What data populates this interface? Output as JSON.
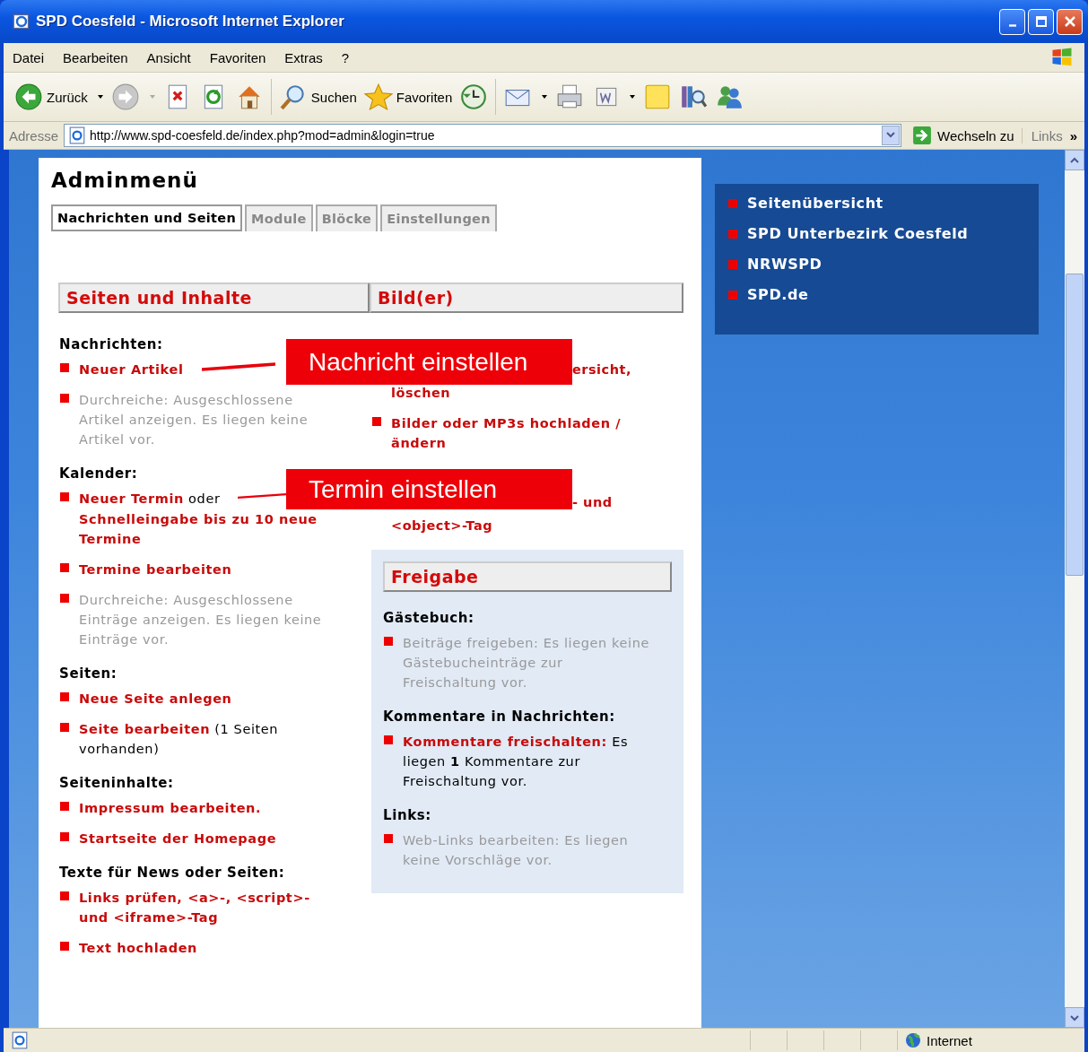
{
  "window": {
    "title": "SPD Coesfeld - Microsoft Internet Explorer"
  },
  "menu": [
    "Datei",
    "Bearbeiten",
    "Ansicht",
    "Favoriten",
    "Extras",
    "?"
  ],
  "toolbar": [
    {
      "kind": "back",
      "label": "Zurück"
    },
    {
      "kind": "forward"
    },
    {
      "kind": "stop"
    },
    {
      "kind": "refresh"
    },
    {
      "kind": "home"
    },
    {
      "kind": "search",
      "label": "Suchen"
    },
    {
      "kind": "favorites",
      "label": "Favoriten"
    },
    {
      "kind": "history"
    },
    {
      "kind": "mail"
    },
    {
      "kind": "print"
    },
    {
      "kind": "edit"
    },
    {
      "kind": "note"
    },
    {
      "kind": "research"
    },
    {
      "kind": "messenger"
    }
  ],
  "address_bar": {
    "label": "Adresse",
    "url": "http://www.spd-coesfeld.de/index.php?mod=admin&login=true",
    "go": "Wechseln zu",
    "links": "Links",
    "chevron": "»"
  },
  "page": {
    "title": "Adminmenü",
    "tabs": [
      {
        "label": "Nachrichten und Seiten",
        "selected": true
      },
      {
        "label": "Module",
        "selected": false
      },
      {
        "label": "Blöcke",
        "selected": false
      },
      {
        "label": "Einstellungen",
        "selected": false
      }
    ],
    "left": {
      "header": "Seiten und Inhalte",
      "groups": [
        {
          "heading": "Nachrichten:",
          "items": [
            {
              "kind": "entry",
              "parts": [
                {
                  "kind": "link",
                  "text": "Neuer Artikel"
                }
              ]
            },
            {
              "kind": "entry",
              "parts": [
                {
                  "kind": "disabled",
                  "text": "Durchreiche: Ausgeschlossene Artikel anzeigen. Es liegen keine Artikel vor."
                }
              ]
            }
          ]
        },
        {
          "heading": "Kalender:",
          "items": [
            {
              "kind": "entry",
              "parts": [
                {
                  "kind": "link",
                  "text": "Neuer Termin"
                },
                {
                  "kind": "text",
                  "text": "oder"
                },
                {
                  "kind": "link",
                  "text": "Schnelleingabe bis zu 10 neue Termine",
                  "block": true
                }
              ]
            },
            {
              "kind": "entry",
              "parts": [
                {
                  "kind": "link",
                  "text": "Termine bearbeiten"
                }
              ]
            },
            {
              "kind": "entry",
              "parts": [
                {
                  "kind": "disabled",
                  "text": "Durchreiche: Ausgeschlossene Einträge anzeigen. Es liegen keine Einträge vor."
                }
              ]
            }
          ]
        },
        {
          "heading": "Seiten:",
          "items": [
            {
              "kind": "entry",
              "parts": [
                {
                  "kind": "link",
                  "text": "Neue Seite anlegen"
                }
              ]
            },
            {
              "kind": "entry",
              "parts": [
                {
                  "kind": "link",
                  "text": "Seite bearbeiten"
                },
                {
                  "kind": "text",
                  "text": "(1 Seiten vorhanden)"
                }
              ]
            }
          ]
        },
        {
          "heading": "Seiteninhalte:",
          "items": [
            {
              "kind": "entry",
              "parts": [
                {
                  "kind": "link",
                  "text": "Impressum bearbeiten."
                }
              ]
            },
            {
              "kind": "entry",
              "parts": [
                {
                  "kind": "link",
                  "text": "Startseite der Homepage"
                }
              ]
            }
          ]
        },
        {
          "heading": "Texte für News oder Seiten:",
          "items": [
            {
              "kind": "entry",
              "parts": [
                {
                  "kind": "link",
                  "text": "Links prüfen, <a>-, <script>- und <iframe>-Tag"
                }
              ]
            },
            {
              "kind": "entry",
              "parts": [
                {
                  "kind": "link",
                  "text": "Text hochladen"
                }
              ]
            }
          ]
        }
      ]
    },
    "right": {
      "header": "Bild(er)",
      "groups": [
        {
          "items": [
            {
              "kind": "fragment",
              "lines": [
                "ersicht,",
                "löschen"
              ]
            },
            {
              "kind": "entry",
              "parts": [
                {
                  "kind": "link",
                  "text": "Bilder oder MP3s hochladen / ändern"
                }
              ]
            }
          ]
        },
        {
          "items": [
            {
              "kind": "fragment",
              "lines": [
                "- und",
                "<object>-Tag"
              ]
            }
          ]
        }
      ]
    },
    "release": {
      "header": "Freigabe",
      "groups": [
        {
          "heading": "Gästebuch:",
          "items": [
            {
              "kind": "entry",
              "parts": [
                {
                  "kind": "disabled",
                  "text": "Beiträge freigeben: Es liegen keine Gästebucheinträge zur Freischaltung vor."
                }
              ]
            }
          ]
        },
        {
          "heading": "Kommentare in Nachrichten:",
          "items": [
            {
              "kind": "entry",
              "parts": [
                {
                  "kind": "link",
                  "text": "Kommentare freischalten:"
                },
                {
                  "kind": "text",
                  "text": "Es liegen **1** Kommentare zur Freischaltung vor."
                }
              ]
            }
          ]
        },
        {
          "heading": "Links:",
          "items": [
            {
              "kind": "entry",
              "parts": [
                {
                  "kind": "disabled",
                  "text": "Web-Links bearbeiten: Es liegen keine Vorschläge vor."
                }
              ]
            }
          ]
        }
      ]
    },
    "callouts": [
      {
        "text": "Nachricht einstellen"
      },
      {
        "text": "Termin einstellen"
      }
    ]
  },
  "sidebar": {
    "items": [
      "Seitenübersicht",
      "SPD Unterbezirk Coesfeld",
      "NRWSPD",
      "SPD.de"
    ]
  },
  "status_bar": {
    "zone": "Internet"
  }
}
